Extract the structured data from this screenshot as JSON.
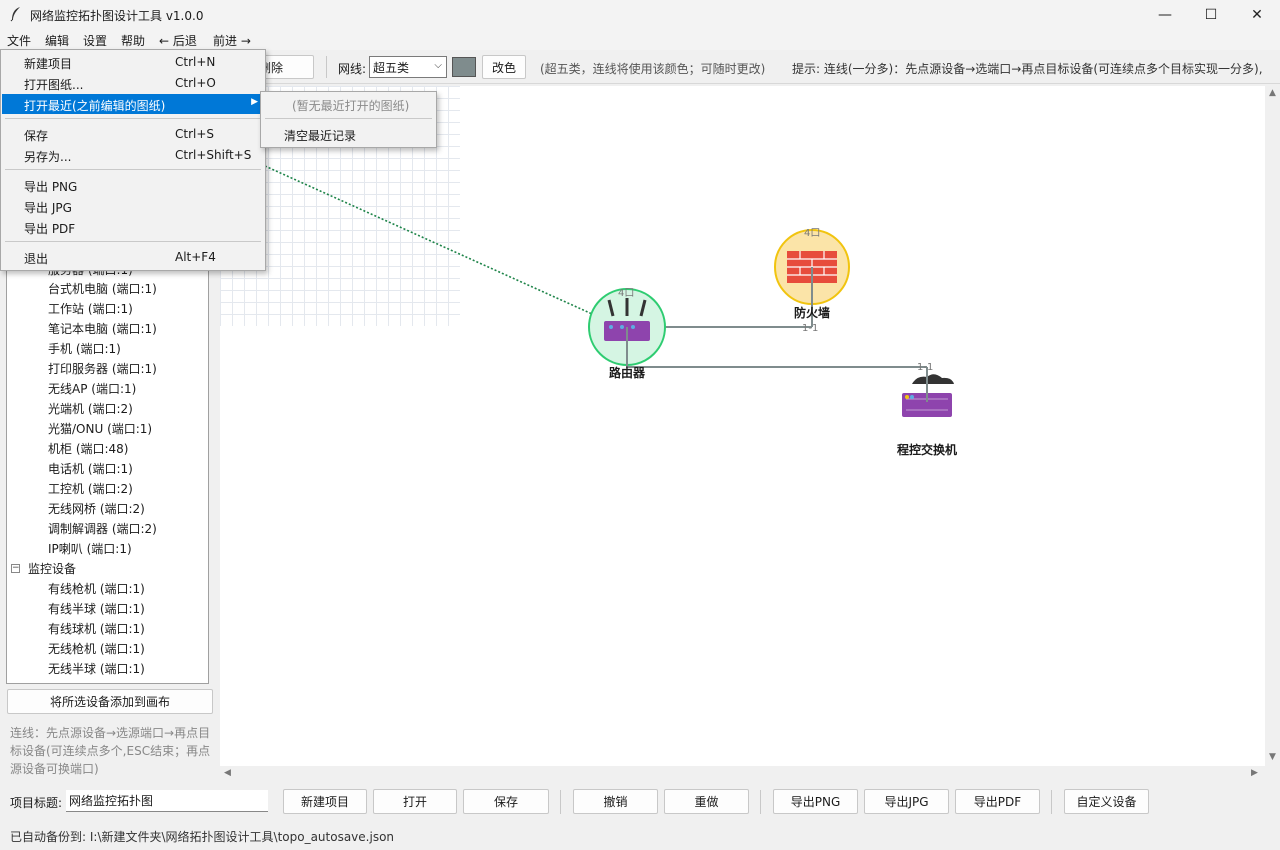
{
  "window": {
    "title": "网络监控拓扑图设计工具  v1.0.0",
    "min": "—",
    "max": "☐",
    "close": "✕"
  },
  "menubar": {
    "items": [
      "文件",
      "编辑",
      "设置",
      "帮助",
      "← 后退",
      "前进 →"
    ]
  },
  "toolbar": {
    "delete_label": "删除",
    "cable_label": "网线:",
    "cable_value": "超五类",
    "cable_color": "#7f8c8d",
    "recolor_label": "改色",
    "cable_hint": "(超五类，连线将使用该颜色；可随时更改)",
    "tip": "提示: 连线(一分多)：先点源设备→选端口→再点目标设备(可连续点多个目标实现一分多),"
  },
  "file_menu": {
    "items": [
      {
        "label": "新建项目",
        "shortcut": "Ctrl+N"
      },
      {
        "label": "打开图纸...",
        "shortcut": "Ctrl+O"
      },
      {
        "label": "打开最近(之前编辑的图纸)",
        "shortcut": ""
      },
      {
        "label": "保存",
        "shortcut": "Ctrl+S"
      },
      {
        "label": "另存为...",
        "shortcut": "Ctrl+Shift+S"
      },
      {
        "label": "导出 PNG",
        "shortcut": ""
      },
      {
        "label": "导出 JPG",
        "shortcut": ""
      },
      {
        "label": "导出 PDF",
        "shortcut": ""
      },
      {
        "label": "退出",
        "shortcut": "Alt+F4"
      }
    ],
    "submenu_arrow": "▶"
  },
  "recent_menu": {
    "empty": "(暂无最近打开的图纸)",
    "clear": "清空最近记录"
  },
  "device_tree": {
    "partial_item": "服务器 (端口:1)",
    "items": [
      "台式机电脑 (端口:1)",
      "工作站 (端口:1)",
      "笔记本电脑 (端口:1)",
      "手机 (端口:1)",
      "打印服务器 (端口:1)",
      "无线AP (端口:1)",
      "光端机 (端口:2)",
      "光猫/ONU (端口:1)",
      "机柜 (端口:48)",
      "电话机 (端口:1)",
      "工控机 (端口:2)",
      "无线网桥 (端口:2)",
      "调制解调器 (端口:2)",
      "IP喇叭 (端口:1)"
    ],
    "category_toggle": "−",
    "category": "监控设备",
    "category_items": [
      "有线枪机 (端口:1)",
      "有线半球 (端口:1)",
      "有线球机 (端口:1)",
      "无线枪机 (端口:1)",
      "无线半球 (端口:1)"
    ]
  },
  "add_button": "将所选设备添加到画布",
  "left_tip": "连线：先点源设备→选源端口→再点目标设备(可连续点多个,ESC结束；再点源设备可换端口)",
  "canvas": {
    "devices": [
      {
        "name": "路由器",
        "ports": "4口",
        "color": "#d5f5e3"
      },
      {
        "name": "防火墙",
        "ports": "4口",
        "color": "#fbe4a8"
      },
      {
        "name": "程控交换机",
        "ports": "1-1",
        "color": "#8e44ad"
      }
    ],
    "link_labels": [
      "1-1",
      "1-1"
    ]
  },
  "bottom": {
    "title_label": "项目标题:",
    "title_value": "网络监控拓扑图",
    "buttons": [
      "新建项目",
      "打开",
      "保存",
      "撤销",
      "重做",
      "导出PNG",
      "导出JPG",
      "导出PDF",
      "自定义设备"
    ]
  },
  "status": "已自动备份到: I:\\新建文件夹\\网络拓扑图设计工具\\topo_autosave.json"
}
